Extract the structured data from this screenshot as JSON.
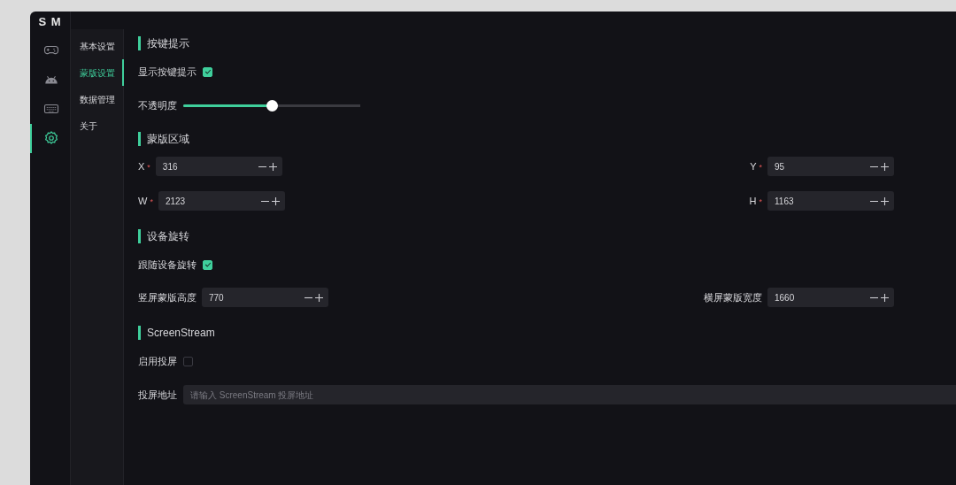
{
  "logo": "S M",
  "rail": [
    {
      "selected": false
    },
    {
      "selected": false
    },
    {
      "selected": false
    },
    {
      "selected": true
    }
  ],
  "subnav": [
    {
      "label": "基本设置",
      "selected": false
    },
    {
      "label": "蒙版设置",
      "selected": true
    },
    {
      "label": "数据管理",
      "selected": false
    },
    {
      "label": "关于",
      "selected": false
    }
  ],
  "sections": [
    {
      "title": "按键提示",
      "items": [
        {
          "kind": "checkbox",
          "label": "显示按键提示",
          "checked": true
        },
        {
          "kind": "slider",
          "label": "不透明度",
          "level": 0.5
        }
      ]
    },
    {
      "title": "蒙版区域",
      "items": [
        {
          "kind": "pair",
          "fields": [
            {
              "label": "X",
              "mark": "*",
              "value": "316"
            },
            {
              "label": "Y",
              "mark": "*",
              "value": "95"
            }
          ]
        },
        {
          "kind": "pair",
          "fields": [
            {
              "label": "W",
              "mark": "*",
              "value": "2123"
            },
            {
              "label": "H",
              "mark": "*",
              "value": "1163"
            }
          ]
        }
      ]
    },
    {
      "title": "设备旋转",
      "items": [
        {
          "kind": "checkbox",
          "label": "跟随设备旋转",
          "checked": true
        },
        {
          "kind": "pair",
          "fields": [
            {
              "label": "竖屏蒙版高度",
              "value": "770"
            },
            {
              "label": "横屏蒙版宽度",
              "value": "1660"
            }
          ]
        }
      ]
    },
    {
      "title": "ScreenStream",
      "items": [
        {
          "kind": "checkbox",
          "label": "启用投屏",
          "checked": false
        },
        {
          "kind": "text",
          "label": "投屏地址",
          "placeholder": "请输入 ScreenStream 投屏地址"
        }
      ]
    }
  ]
}
